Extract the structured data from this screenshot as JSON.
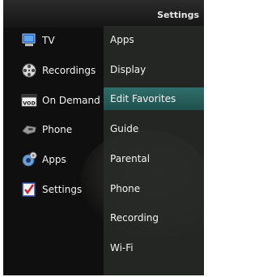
{
  "header": {
    "title": "Settings"
  },
  "left_menu": [
    {
      "label": "TV",
      "icon": "tv-icon"
    },
    {
      "label": "Recordings",
      "icon": "film-reel-icon"
    },
    {
      "label": "On Demand",
      "icon": "vod-icon"
    },
    {
      "label": "Phone",
      "icon": "phone-icon"
    },
    {
      "label": "Apps",
      "icon": "apps-gear-icon"
    },
    {
      "label": "Settings",
      "icon": "settings-checklist-icon"
    }
  ],
  "right_menu": [
    {
      "label": "Apps"
    },
    {
      "label": "Display"
    },
    {
      "label": "Edit Favorites",
      "selected": true
    },
    {
      "label": "Guide"
    },
    {
      "label": "Parental"
    },
    {
      "label": "Phone"
    },
    {
      "label": "Recording"
    },
    {
      "label": "Wi-Fi"
    }
  ],
  "vod_icon_text": "VOD",
  "colors": {
    "background": "#0e0f0e",
    "panel": "#2a2c2a",
    "highlight": "#2f6f6c",
    "text": "#f2f2f2"
  }
}
